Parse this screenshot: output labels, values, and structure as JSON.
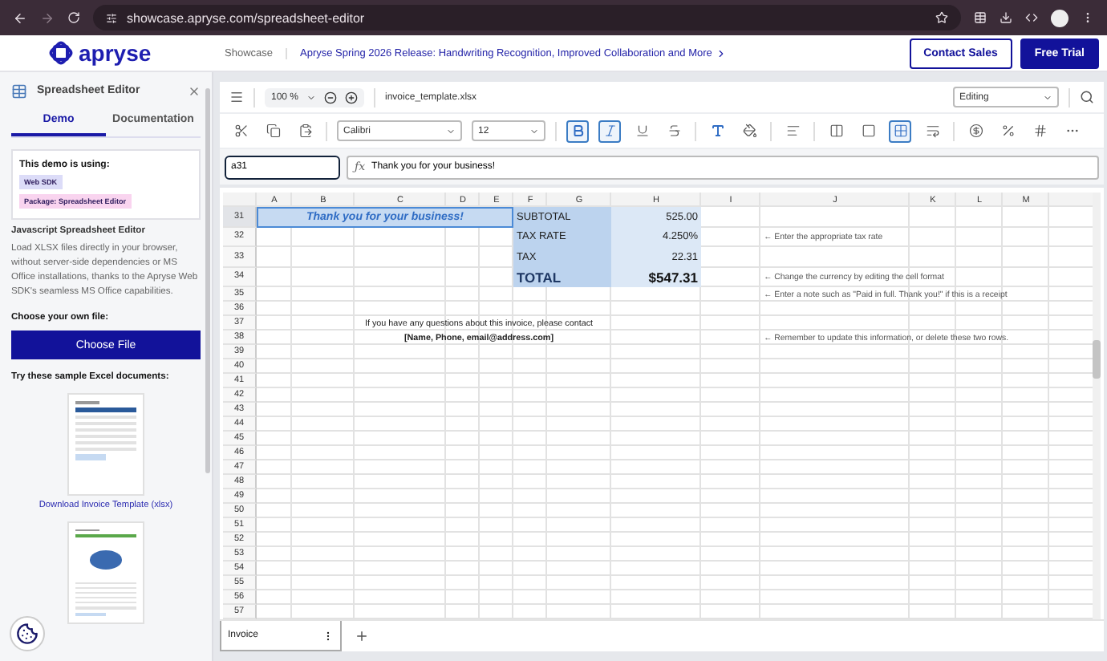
{
  "browser": {
    "url": "showcase.apryse.com/spreadsheet-editor"
  },
  "header": {
    "logo": "apryse",
    "nav": "Showcase",
    "announcement": "Apryse Spring 2026 Release: Handwriting Recognition, Improved Collaboration and More",
    "buttons": [
      {
        "label": "Contact Sales",
        "kind": "outline"
      },
      {
        "label": "Free Trial",
        "kind": "filled"
      }
    ]
  },
  "sidebar": {
    "title": "Spreadsheet Editor",
    "tabs": [
      {
        "label": "Demo",
        "selected": true
      },
      {
        "label": "Documentation",
        "selected": false
      }
    ],
    "card": {
      "heading": "This demo is using:",
      "badges": [
        {
          "label": "Web SDK",
          "color": "#dcdcf8"
        },
        {
          "label": "Package: Spreadsheet Editor",
          "color": "#f9d4ef"
        }
      ]
    },
    "section_title": "Javascript Spreadsheet Editor",
    "description": "Load XLSX files directly in your browser, without server-side dependencies or MS Office installations, thanks to the Apryse Web SDK's seamless MS Office capabilities.",
    "choose_label": "Choose your own file:",
    "choose_button": "Choose File",
    "samples_label": "Try these sample Excel documents:",
    "samples": [
      {
        "caption": "Download Invoice Template (xlsx)"
      },
      {
        "kind": "chart"
      }
    ]
  },
  "toolbar": {
    "zoom": "100 %",
    "filename": "invoice_template.xlsx",
    "mode": "Editing",
    "font": "Calibri",
    "size": "12",
    "tools": [
      {
        "kind": "cut",
        "selected": false
      },
      {
        "kind": "copy",
        "selected": false
      },
      {
        "kind": "paste",
        "selected": false
      },
      {
        "kind": "font"
      },
      {
        "kind": "size"
      },
      {
        "kind": "bold",
        "selected": true
      },
      {
        "kind": "italic",
        "selected": true
      },
      {
        "kind": "underline",
        "selected": false
      },
      {
        "kind": "strike",
        "selected": false
      },
      {
        "kind": "textcolor",
        "selected": false
      },
      {
        "kind": "fill",
        "selected": false
      },
      {
        "kind": "align",
        "selected": false
      },
      {
        "kind": "border",
        "selected": false
      },
      {
        "kind": "frame",
        "selected": false
      },
      {
        "kind": "merge",
        "selected": true
      },
      {
        "kind": "wrap",
        "selected": false
      },
      {
        "kind": "currency",
        "selected": false
      },
      {
        "kind": "percent",
        "selected": false
      },
      {
        "kind": "decimal",
        "selected": false
      },
      {
        "kind": "more",
        "selected": false
      }
    ]
  },
  "formula": {
    "cell": "a31",
    "symbol": "ƒx",
    "content": "Thank you for your business!"
  },
  "grid": {
    "columns": [
      "A",
      "B",
      "C",
      "D",
      "E",
      "F",
      "G",
      "H",
      "I",
      "J",
      "K",
      "L",
      "M"
    ],
    "rows": [
      {
        "number": "31",
        "kind": "tall",
        "selected": true,
        "cells": [
          {
            "kind": "thanks",
            "text": "Thank you for your business!",
            "selected": true
          },
          "",
          "",
          "",
          "",
          {
            "kind": "label",
            "text": "SUBTOTAL"
          },
          "",
          {
            "kind": "value",
            "text": "525.00"
          },
          "",
          "",
          "",
          "",
          ""
        ]
      },
      {
        "number": "32",
        "kind": "tall",
        "selected": false,
        "cells": [
          "",
          "",
          "",
          "",
          "",
          {
            "kind": "label",
            "text": "TAX RATE"
          },
          "",
          {
            "kind": "value",
            "text": "4.250%"
          },
          "",
          {
            "kind": "note",
            "text": "← Enter the appropriate tax rate"
          },
          "",
          "",
          ""
        ]
      },
      {
        "number": "33",
        "kind": "tall",
        "selected": false,
        "cells": [
          "",
          "",
          "",
          "",
          "",
          {
            "kind": "label",
            "text": "TAX"
          },
          "",
          {
            "kind": "value",
            "text": "22.31"
          },
          "",
          "",
          "",
          "",
          ""
        ]
      },
      {
        "number": "34",
        "kind": "tall",
        "selected": false,
        "cells": [
          "",
          "",
          "",
          "",
          "",
          {
            "kind": "total_label",
            "text": "TOTAL"
          },
          "",
          {
            "kind": "total_value",
            "text": "$547.31"
          },
          "",
          {
            "kind": "note",
            "text": "← Change the currency by editing the cell format"
          },
          "",
          "",
          ""
        ]
      },
      {
        "number": "35",
        "kind": "normal",
        "selected": false,
        "cells": [
          "",
          "",
          "",
          "",
          "",
          "",
          "",
          "",
          "",
          {
            "kind": "note",
            "text": "← Enter a note such as \"Paid in full. Thank you!\" if this is a receipt"
          },
          "",
          "",
          ""
        ]
      },
      {
        "number": "36",
        "kind": "normal",
        "selected": false
      },
      {
        "number": "37",
        "kind": "normal",
        "selected": false,
        "cells": [
          {
            "kind": "contact",
            "text": "If you have any questions about this invoice, please contact"
          },
          "",
          "",
          "",
          "",
          "",
          "",
          "",
          "",
          "",
          "",
          "",
          ""
        ]
      },
      {
        "number": "38",
        "kind": "normal",
        "selected": false,
        "cells": [
          {
            "kind": "contact_bold",
            "text": "[Name, Phone, email@address.com]"
          },
          "",
          "",
          "",
          "",
          "",
          "",
          "",
          "",
          {
            "kind": "note",
            "text": "← Remember to update this information, or delete these two rows."
          },
          "",
          "",
          ""
        ]
      },
      {
        "number": "39",
        "kind": "normal",
        "selected": false
      },
      {
        "number": "40",
        "kind": "normal",
        "selected": false
      },
      {
        "number": "41",
        "kind": "normal",
        "selected": false
      },
      {
        "number": "42",
        "kind": "normal",
        "selected": false
      },
      {
        "number": "43",
        "kind": "normal",
        "selected": false
      },
      {
        "number": "44",
        "kind": "normal",
        "selected": false
      },
      {
        "number": "45",
        "kind": "normal",
        "selected": false
      },
      {
        "number": "46",
        "kind": "normal",
        "selected": false
      },
      {
        "number": "47",
        "kind": "normal",
        "selected": false
      },
      {
        "number": "48",
        "kind": "normal",
        "selected": false
      },
      {
        "number": "49",
        "kind": "normal",
        "selected": false
      },
      {
        "number": "50",
        "kind": "normal",
        "selected": false
      },
      {
        "number": "51",
        "kind": "normal",
        "selected": false
      },
      {
        "number": "52",
        "kind": "normal",
        "selected": false
      },
      {
        "number": "53",
        "kind": "normal",
        "selected": false
      },
      {
        "number": "54",
        "kind": "normal",
        "selected": false
      },
      {
        "number": "55",
        "kind": "normal",
        "selected": false
      },
      {
        "number": "56",
        "kind": "normal",
        "selected": false
      },
      {
        "number": "57",
        "kind": "normal",
        "selected": false
      }
    ]
  },
  "sheets": [
    {
      "label": "Invoice",
      "selected": true
    }
  ]
}
